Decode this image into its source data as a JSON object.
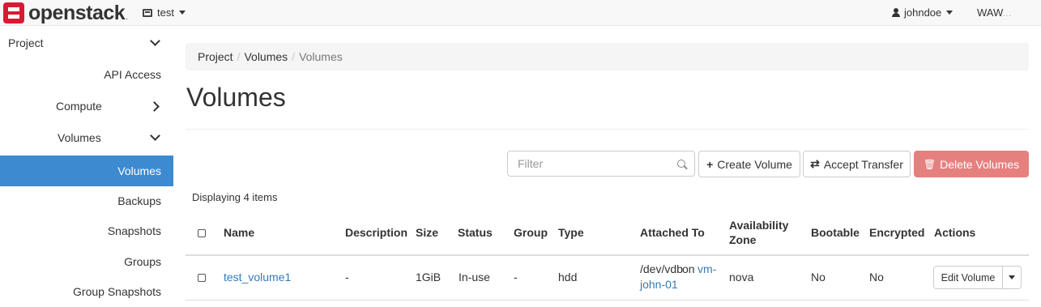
{
  "header": {
    "brand": "openstack",
    "project": "test",
    "user": "johndoe",
    "region_visible": "WAW",
    "region_faded": "..."
  },
  "sidebar": {
    "items": [
      {
        "label": "Project",
        "state": "expanded"
      },
      {
        "label": "API Access"
      },
      {
        "label": "Compute",
        "state": "collapsed"
      },
      {
        "label": "Volumes",
        "state": "expanded"
      },
      {
        "label": "Volumes",
        "active": true
      },
      {
        "label": "Backups"
      },
      {
        "label": "Snapshots"
      },
      {
        "label": "Groups"
      },
      {
        "label": "Group Snapshots"
      }
    ],
    "active_color": "#3d8ad1"
  },
  "breadcrumb": [
    "Project",
    "Volumes",
    "Volumes"
  ],
  "page_title": "Volumes",
  "toolbar": {
    "filter_placeholder": "Filter",
    "create_label": "Create Volume",
    "accept_label": "Accept Transfer",
    "delete_label": "Delete Volumes",
    "delete_color": "#e5807f"
  },
  "table": {
    "displaying": "Displaying 4 items",
    "headers": {
      "name": "Name",
      "description": "Description",
      "size": "Size",
      "status": "Status",
      "group": "Group",
      "type": "Type",
      "attached_to": "Attached To",
      "az_line1": "Availability",
      "az_line2": "Zone",
      "bootable": "Bootable",
      "encrypted": "Encrypted",
      "actions": "Actions"
    },
    "rows": [
      {
        "name": "test_volume1",
        "description": "-",
        "size": "1GiB",
        "status": "In-use",
        "group": "-",
        "type": "hdd",
        "attached_device": "/dev/vdb",
        "attached_on": "on",
        "attached_vm_part1": "vm-",
        "attached_vm_part2": "john-01",
        "az": "nova",
        "bootable": "No",
        "encrypted": "No",
        "action": "Edit Volume"
      }
    ]
  }
}
